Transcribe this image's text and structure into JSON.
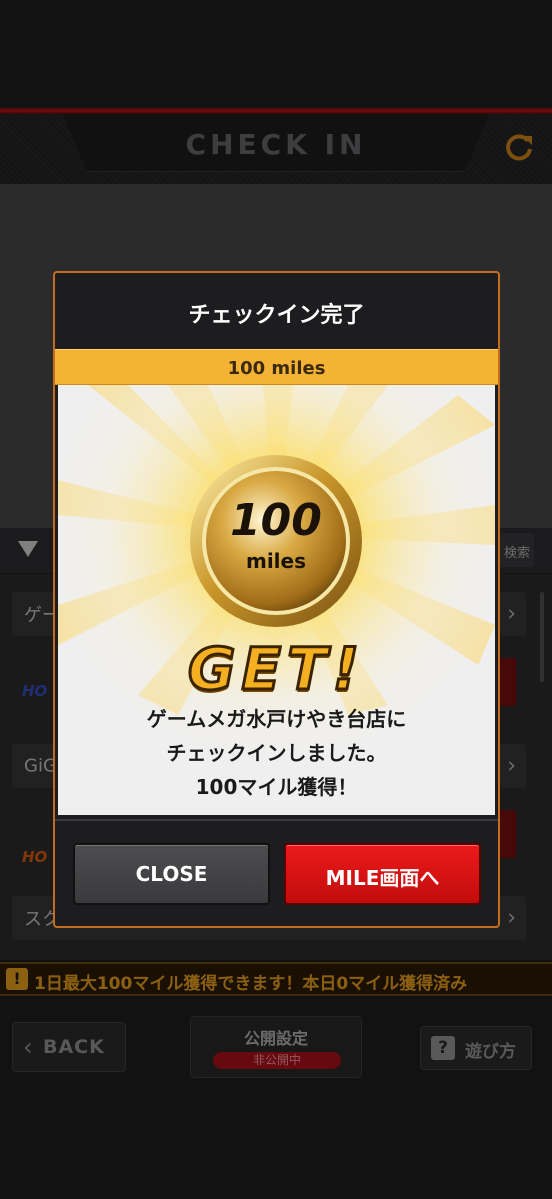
{
  "header": {
    "title": "CHECK IN",
    "refresh_icon": "refresh-icon"
  },
  "list": {
    "search_label": "検索",
    "rows": [
      {
        "label": "ゲー"
      },
      {
        "label": "GiG"
      },
      {
        "label": "スク"
      }
    ],
    "logo_text": "HO"
  },
  "notice": {
    "icon": "!",
    "text": "1日最大100マイル獲得できます！本日0マイル獲得済み"
  },
  "footer": {
    "back_label": "BACK",
    "publish_label": "公開設定",
    "publish_status": "非公開中",
    "howto_icon": "?",
    "howto_label": "遊び方"
  },
  "modal": {
    "title": "チェックイン完了",
    "miles_bar": "100 miles",
    "coin_value": "100",
    "coin_unit": "miles",
    "get_text": "GET!",
    "message_lines": [
      "ゲームメガ水戸けやき台店に",
      "チェックインしました。",
      "100マイル獲得！"
    ],
    "close_label": "CLOSE",
    "mile_label": "MILE画面へ"
  },
  "colors": {
    "accent_orange": "#f5b335",
    "modal_border": "#c36e1e",
    "primary_red": "#d41414",
    "notice_text": "#f2a51e"
  }
}
